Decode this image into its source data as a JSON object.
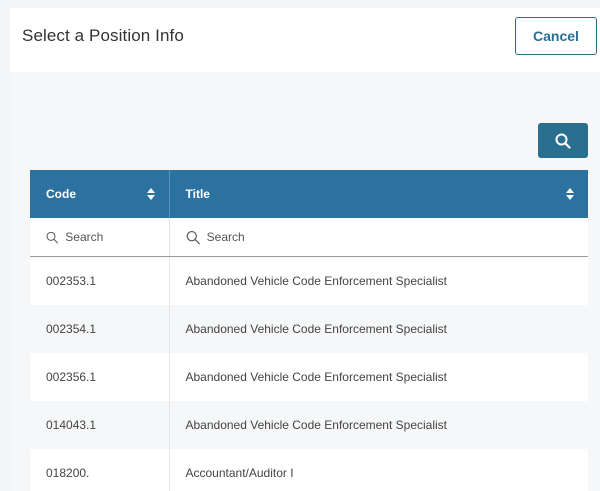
{
  "header": {
    "title": "Select a Position Info",
    "cancel_label": "Cancel"
  },
  "toolbar": {
    "search_icon": "search-icon"
  },
  "table": {
    "columns": [
      {
        "label": "Code",
        "sort_icon": "sort-icon"
      },
      {
        "label": "Title",
        "sort_icon": "sort-icon"
      }
    ],
    "filters": {
      "code_placeholder": "Search",
      "title_placeholder": "Search"
    },
    "rows": [
      {
        "code": "002353.1",
        "title": "Abandoned Vehicle Code Enforcement Specialist"
      },
      {
        "code": "002354.1",
        "title": "Abandoned Vehicle Code Enforcement Specialist"
      },
      {
        "code": "002356.1",
        "title": "Abandoned Vehicle Code Enforcement Specialist"
      },
      {
        "code": "014043.1",
        "title": "Abandoned Vehicle Code Enforcement Specialist"
      },
      {
        "code": "018200.",
        "title": "Accountant/Auditor I"
      }
    ]
  },
  "colors": {
    "accent": "#2a6e90",
    "header_bg": "#2c72a0"
  }
}
